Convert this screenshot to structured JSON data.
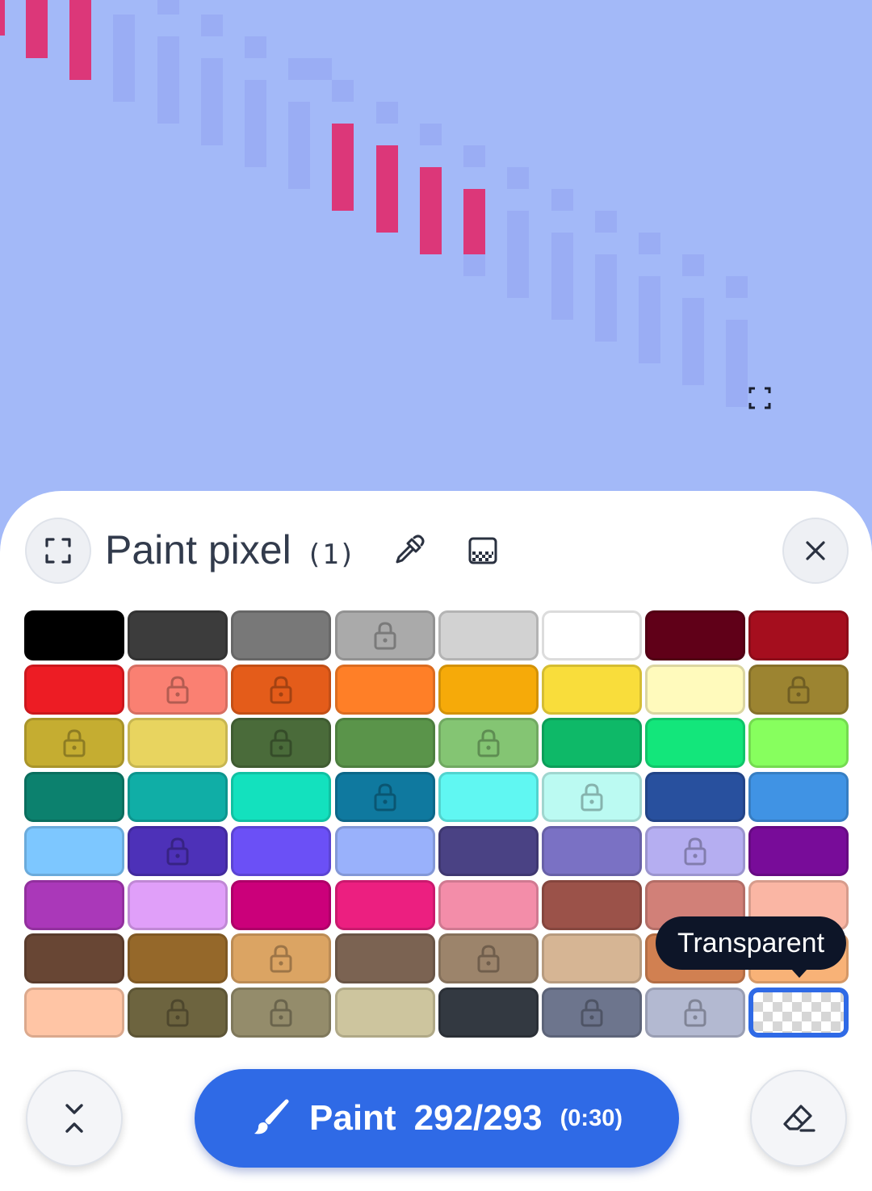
{
  "canvas": {
    "background_color": "#a3b9f8",
    "painted_color": "#dc3779",
    "ghost_color": "#9aadf4"
  },
  "panel": {
    "title": "Paint pixel",
    "count": "(1)",
    "icons": {
      "expand": "expand-icon",
      "pipette": "pipette-icon",
      "transparency": "transparency-icon",
      "close": "close-icon"
    }
  },
  "palette": {
    "selected": "Transparent",
    "colors": [
      {
        "color": "#000000",
        "locked": false
      },
      {
        "color": "#3c3c3c",
        "locked": false
      },
      {
        "color": "#787878",
        "locked": false
      },
      {
        "color": "#aaaaaa",
        "locked": true
      },
      {
        "color": "#d2d2d2",
        "locked": false
      },
      {
        "color": "#ffffff",
        "locked": false
      },
      {
        "color": "#600018",
        "locked": false
      },
      {
        "color": "#a50e1e",
        "locked": false
      },
      {
        "color": "#ed1c24",
        "locked": false
      },
      {
        "color": "#fa8072",
        "locked": true
      },
      {
        "color": "#e45c1a",
        "locked": true
      },
      {
        "color": "#ff7f27",
        "locked": false
      },
      {
        "color": "#f6aa09",
        "locked": false
      },
      {
        "color": "#f9dd3b",
        "locked": false
      },
      {
        "color": "#fffabc",
        "locked": false
      },
      {
        "color": "#9c8431",
        "locked": true
      },
      {
        "color": "#c5ad31",
        "locked": true
      },
      {
        "color": "#e8d45f",
        "locked": false
      },
      {
        "color": "#4a6b3a",
        "locked": true
      },
      {
        "color": "#5a944a",
        "locked": false
      },
      {
        "color": "#84c573",
        "locked": true
      },
      {
        "color": "#0eb968",
        "locked": false
      },
      {
        "color": "#13e67b",
        "locked": false
      },
      {
        "color": "#87ff5e",
        "locked": false
      },
      {
        "color": "#0c816e",
        "locked": false
      },
      {
        "color": "#10aea6",
        "locked": false
      },
      {
        "color": "#13e1be",
        "locked": false
      },
      {
        "color": "#0f799f",
        "locked": true
      },
      {
        "color": "#60f7f2",
        "locked": false
      },
      {
        "color": "#bbfaf2",
        "locked": true
      },
      {
        "color": "#28509e",
        "locked": false
      },
      {
        "color": "#4093e4",
        "locked": false
      },
      {
        "color": "#7dc7ff",
        "locked": false
      },
      {
        "color": "#4d31b8",
        "locked": true
      },
      {
        "color": "#6b50f6",
        "locked": false
      },
      {
        "color": "#99b1fb",
        "locked": false
      },
      {
        "color": "#4a4284",
        "locked": false
      },
      {
        "color": "#7a71c4",
        "locked": false
      },
      {
        "color": "#b5aef1",
        "locked": true
      },
      {
        "color": "#780c99",
        "locked": false
      },
      {
        "color": "#aa38b9",
        "locked": false
      },
      {
        "color": "#e09ff9",
        "locked": false
      },
      {
        "color": "#cb007a",
        "locked": false
      },
      {
        "color": "#ec1f80",
        "locked": false
      },
      {
        "color": "#f38da9",
        "locked": false
      },
      {
        "color": "#9b5249",
        "locked": false
      },
      {
        "color": "#d18078",
        "locked": false
      },
      {
        "color": "#fab6a4",
        "locked": false
      },
      {
        "color": "#684634",
        "locked": false
      },
      {
        "color": "#95682a",
        "locked": false
      },
      {
        "color": "#dba463",
        "locked": true
      },
      {
        "color": "#7b6352",
        "locked": false
      },
      {
        "color": "#9c846b",
        "locked": true
      },
      {
        "color": "#d6b594",
        "locked": false
      },
      {
        "color": "#d18051",
        "locked": false
      },
      {
        "color": "#f8b277",
        "locked": false
      },
      {
        "color": "#ffc5a5",
        "locked": false
      },
      {
        "color": "#6d643f",
        "locked": true
      },
      {
        "color": "#948c6b",
        "locked": true
      },
      {
        "color": "#cdc59e",
        "locked": false
      },
      {
        "color": "#333941",
        "locked": false
      },
      {
        "color": "#6d758d",
        "locked": true
      },
      {
        "color": "#b3b9d1",
        "locked": true
      },
      {
        "color": "transparent",
        "locked": false
      }
    ]
  },
  "tooltip": {
    "text": "Transparent"
  },
  "paint_button": {
    "label": "Paint",
    "count": "292/293",
    "timer": "(0:30)",
    "icon": "brush-icon"
  },
  "bottom": {
    "collapse_icon": "collapse-icon",
    "eraser_icon": "eraser-icon"
  }
}
